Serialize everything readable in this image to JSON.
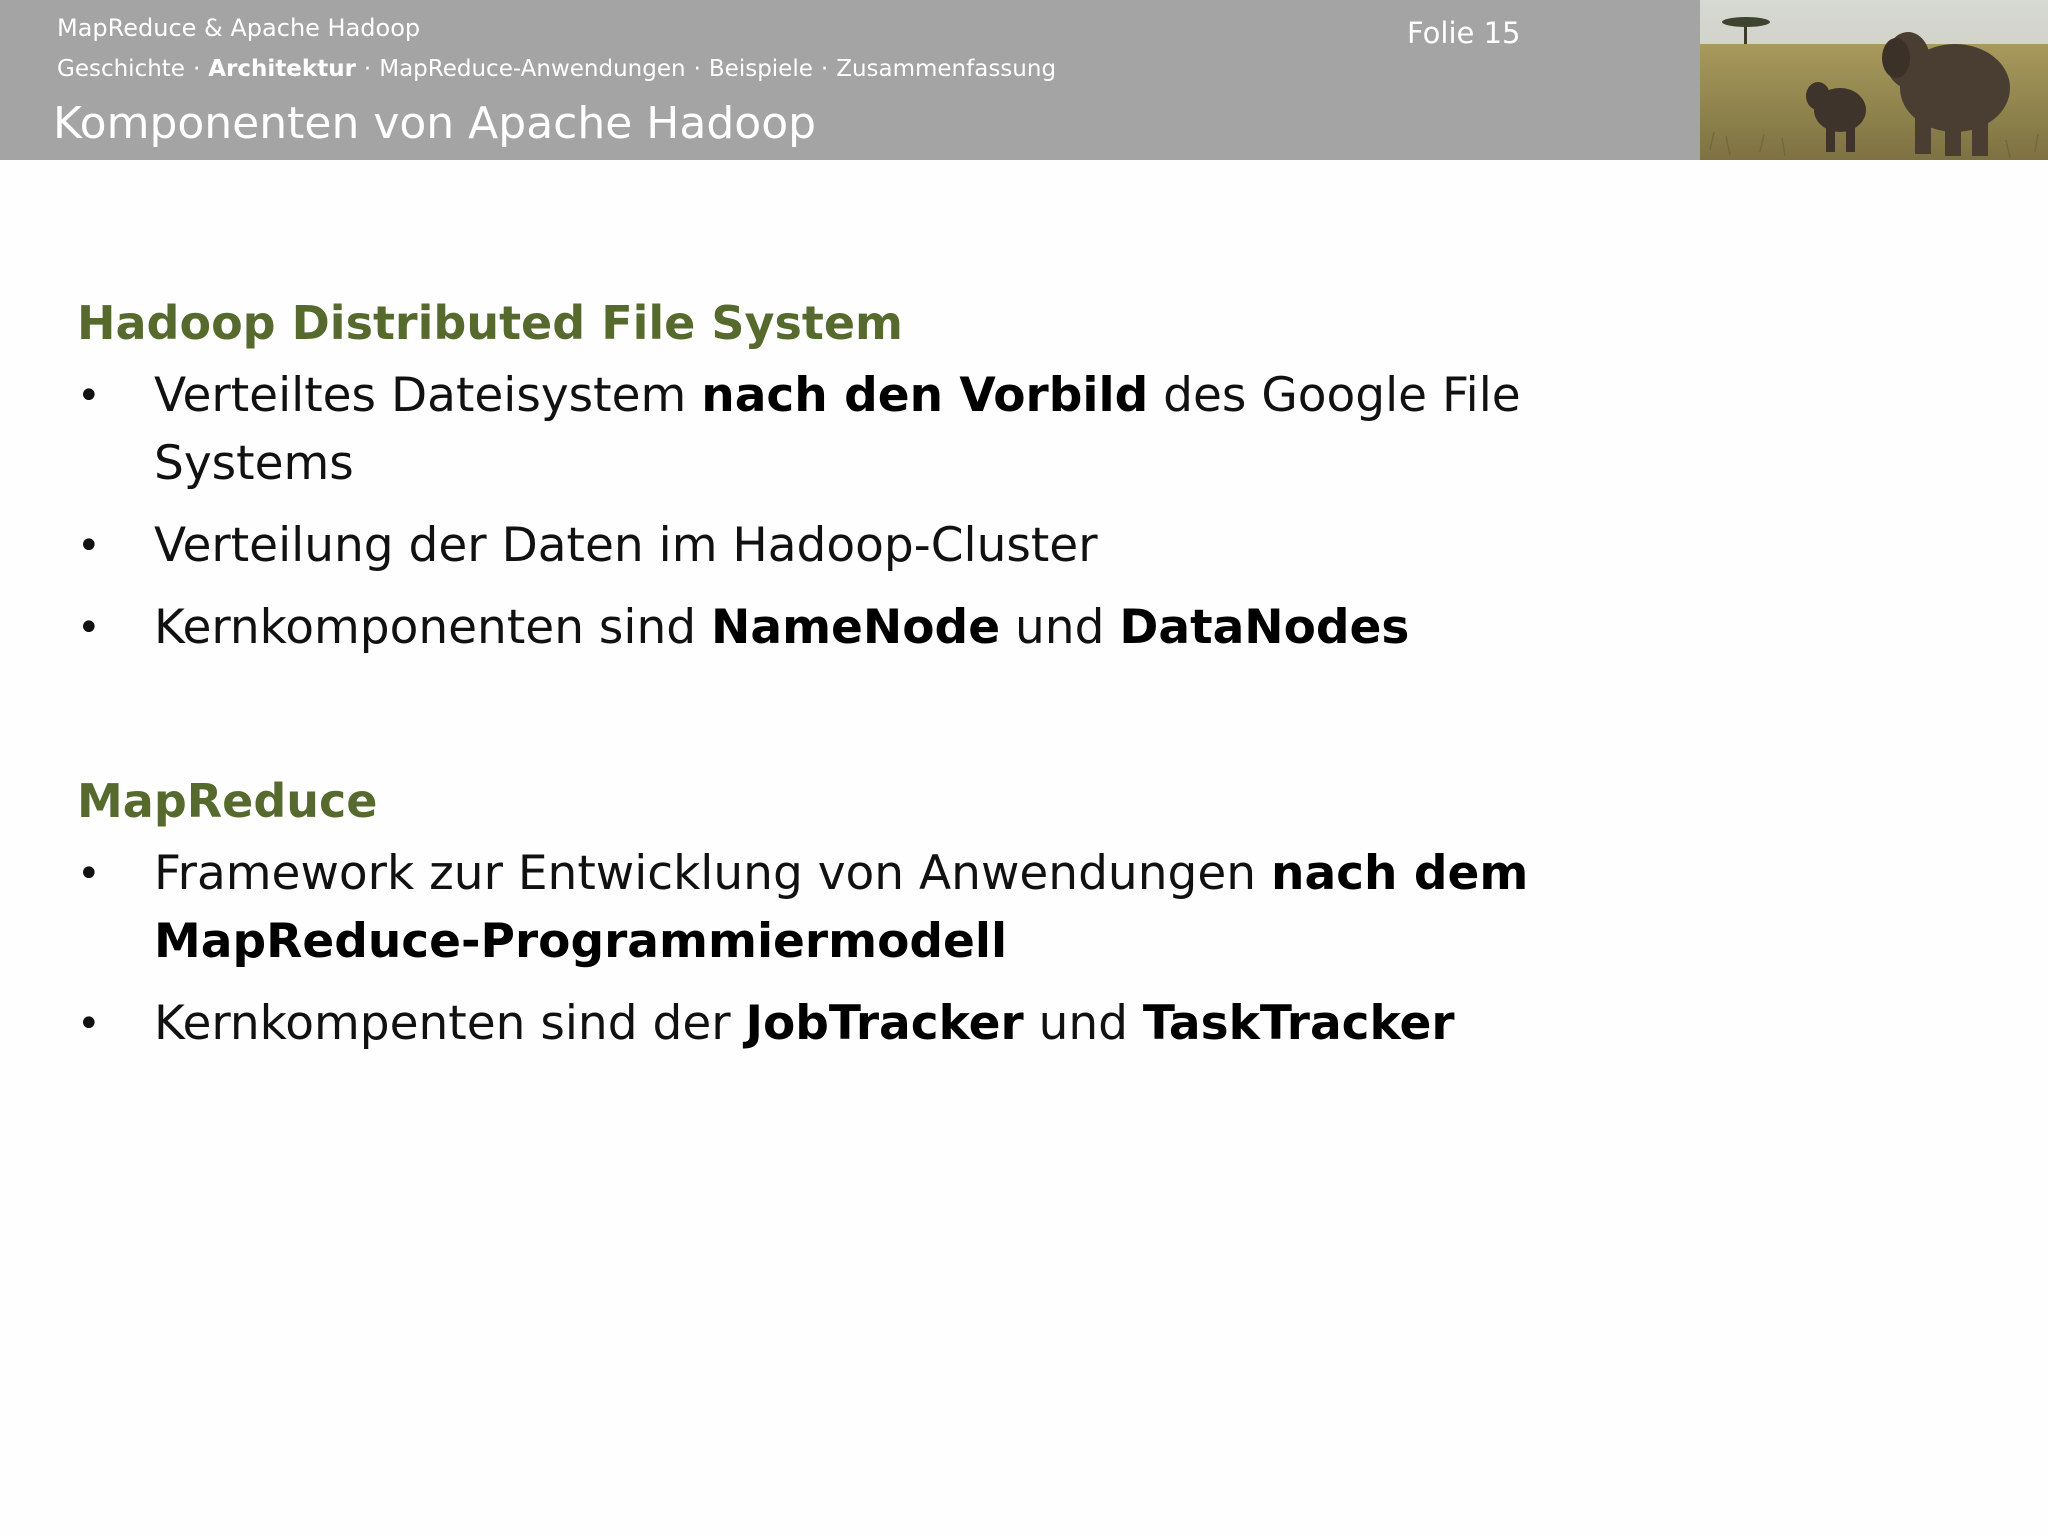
{
  "header": {
    "course_title": "MapReduce & Apache Hadoop",
    "slide_number": "Folie 15",
    "slide_title": "Komponenten von Apache Hadoop",
    "breadcrumb": [
      {
        "label": "Geschichte",
        "active": false
      },
      {
        "label": "Architektur",
        "active": true
      },
      {
        "label": "MapReduce-Anwendungen",
        "active": false
      },
      {
        "label": "Beispiele",
        "active": false
      },
      {
        "label": "Zusammenfassung",
        "active": false
      }
    ],
    "separator": "·",
    "bar_color": "#a4a4a4",
    "photo": "elephants-savanna-image"
  },
  "sections": [
    {
      "heading": "Hadoop Distributed File System",
      "bullets": [
        [
          {
            "text": "Verteiltes Dateisystem ",
            "bold": false
          },
          {
            "text": "nach den Vorbild",
            "bold": true
          },
          {
            "text": " des Google File Systems",
            "bold": false
          }
        ],
        [
          {
            "text": "Verteilung der Daten im Hadoop-Cluster",
            "bold": false
          }
        ],
        [
          {
            "text": "Kernkomponenten sind ",
            "bold": false
          },
          {
            "text": "NameNode",
            "bold": true
          },
          {
            "text": " und ",
            "bold": false
          },
          {
            "text": "DataNodes",
            "bold": true
          }
        ]
      ]
    },
    {
      "heading": "MapReduce",
      "bullets": [
        [
          {
            "text": "Framework zur Entwicklung von Anwendungen ",
            "bold": false
          },
          {
            "text": "nach dem MapReduce-Programmiermodell",
            "bold": true
          }
        ],
        [
          {
            "text": "Kernkompenten sind der ",
            "bold": false
          },
          {
            "text": "JobTracker",
            "bold": true
          },
          {
            "text": " und ",
            "bold": false
          },
          {
            "text": "TaskTracker",
            "bold": true
          }
        ]
      ]
    }
  ],
  "bullet_glyph": "•",
  "colors": {
    "heading": "#576a2e",
    "header_text": "#ffffff"
  }
}
